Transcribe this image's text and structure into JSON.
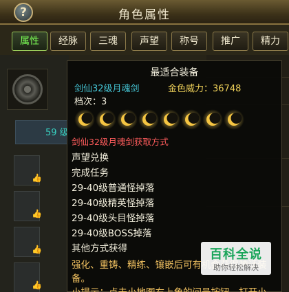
{
  "window": {
    "title": "角色属性",
    "help_label": "?"
  },
  "tabs": [
    {
      "label": "属性",
      "active": true
    },
    {
      "label": "经脉",
      "active": false
    },
    {
      "label": "三魂",
      "active": false
    },
    {
      "label": "声望",
      "active": false
    },
    {
      "label": "称号",
      "active": false
    },
    {
      "label": "推广",
      "active": false
    },
    {
      "label": "精力",
      "active": false
    }
  ],
  "background": {
    "level_text": "59 级"
  },
  "tooltip": {
    "title": "最适合装备",
    "item_name": "剑仙32级月魂剑",
    "power_label": "金色威力：36748",
    "rank_label": "档次：3",
    "moon_count": 8,
    "source_heading": "剑仙32级月魂剑获取方式",
    "sources": [
      "声望兑换",
      "完成任务",
      "29-40级普通怪掉落",
      "29-40级精英怪掉落",
      "29-40级头目怪掉落",
      "29-40级BOSS掉落",
      "其他方式获得"
    ],
    "description": "强化、重铸、精练、镶嵌后可有机会获得神话装备。",
    "tip": "小提示：点击小地图右上角的问号按钮，打开小"
  },
  "watermark": {
    "main": "百科全说",
    "sub": "助你轻松解决"
  },
  "colors": {
    "active_tab": "#7cff56",
    "item_name": "#46c8d8",
    "power": "#f0d25a",
    "source_heading": "#ff5c5c",
    "description": "#f0c060"
  }
}
